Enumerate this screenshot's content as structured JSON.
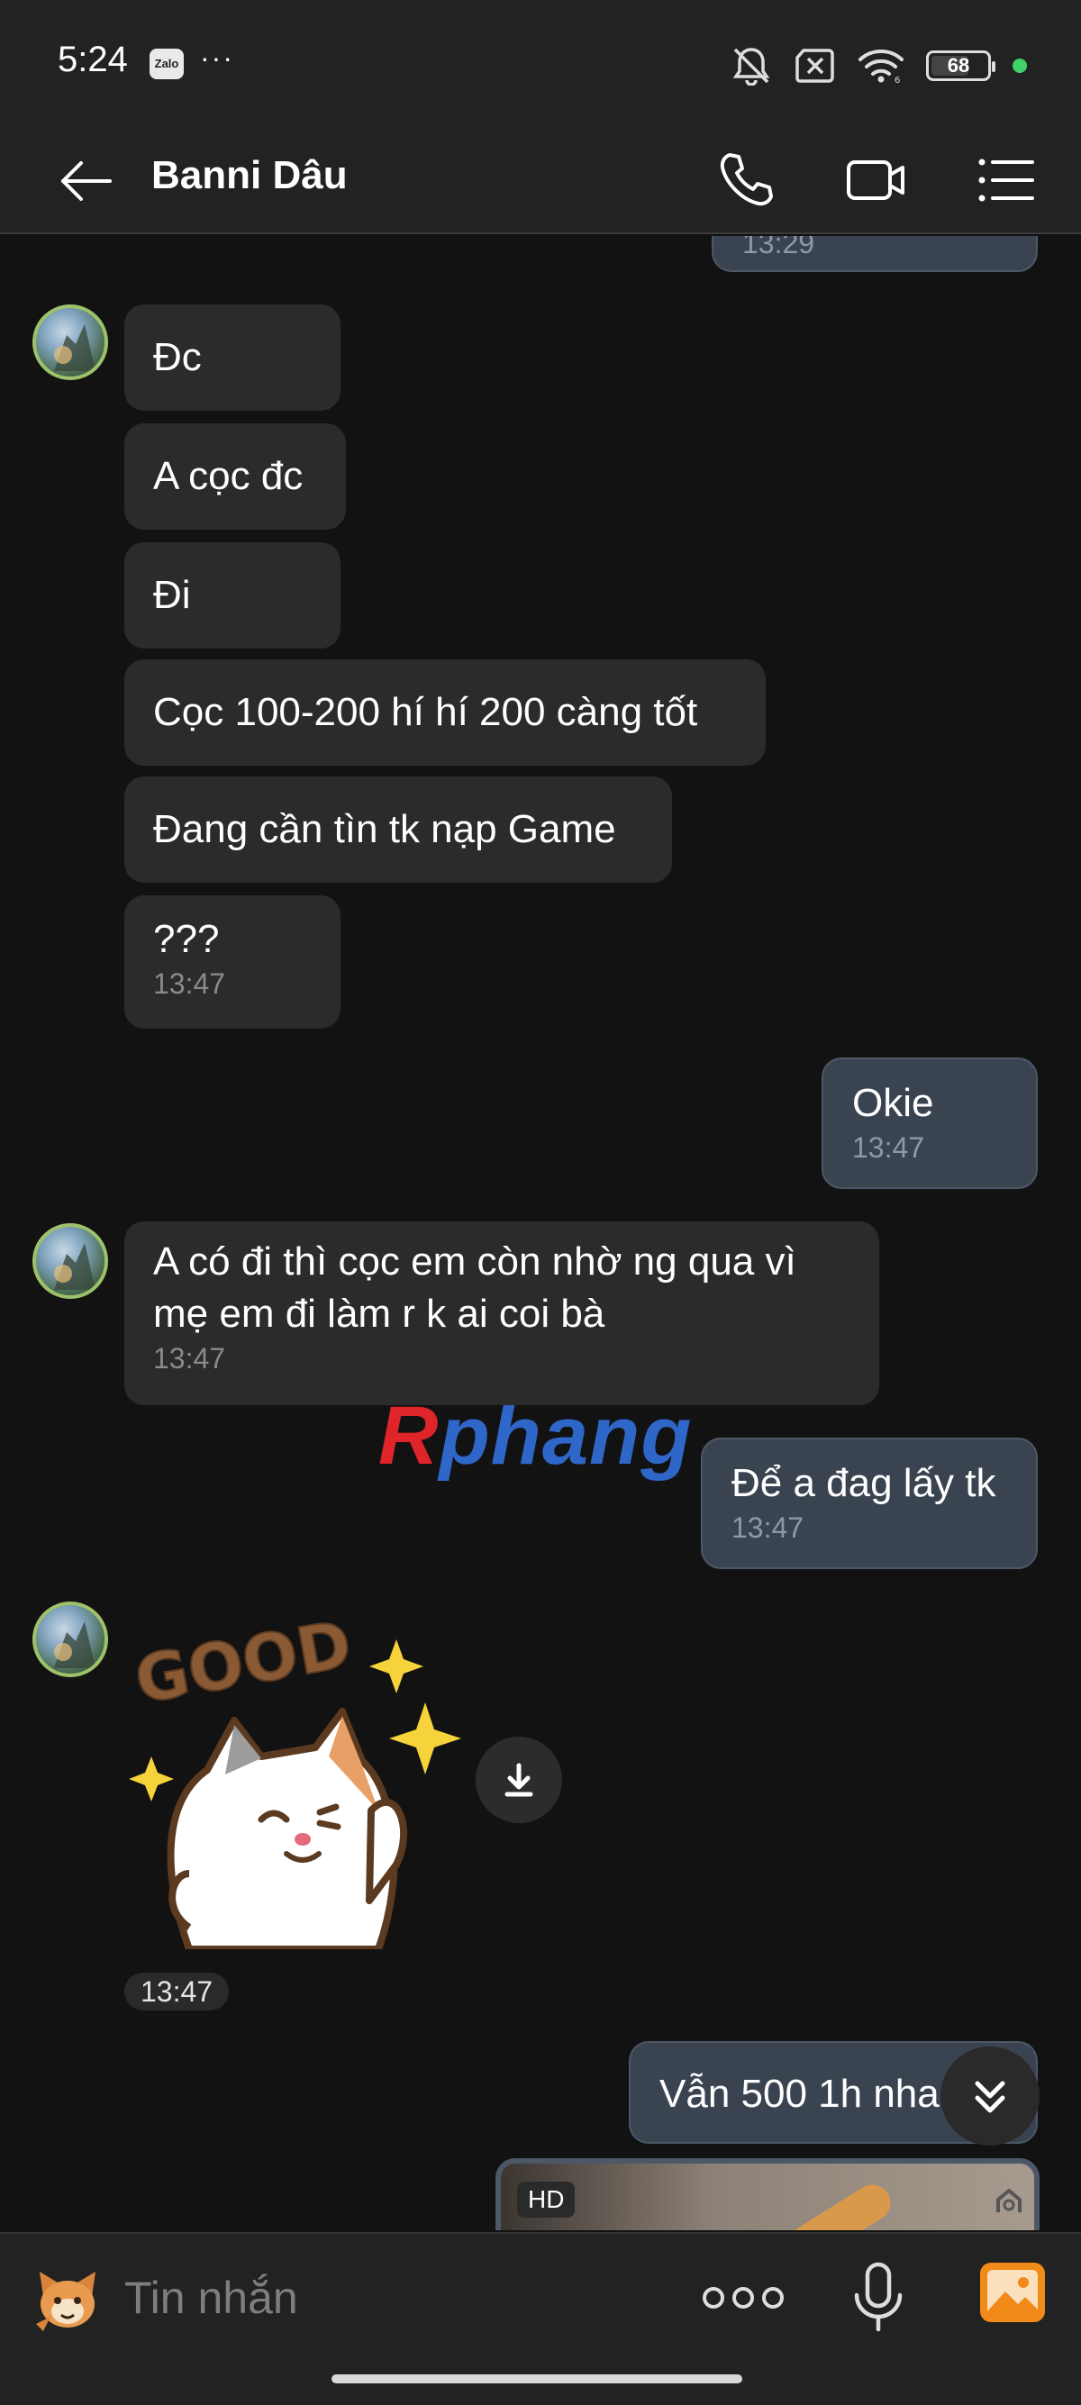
{
  "status_bar": {
    "time": "5:24",
    "app_badge": "Zalo",
    "more": "···",
    "battery": "68",
    "battery_level_percent": 68
  },
  "header": {
    "contact_name": "Banni Dâu"
  },
  "messages": {
    "top_partial_time": "13:29",
    "m1": "Đc",
    "m2": "A cọc đc",
    "m3": "Đi",
    "m4": "Cọc 100-200 hí hí 200 càng tốt",
    "m5": "Đang cần tìn tk nạp Game",
    "m6": "???",
    "m6_time": "13:47",
    "out1": "Okie",
    "out1_time": "13:47",
    "m7": "A có đi thì cọc em còn nhờ ng qua vì mẹ em đi làm r k ai coi bà",
    "m7_time": "13:47",
    "out2": "Để a đag lấy tk",
    "out2_time": "13:47",
    "sticker_text": "GOOD",
    "sticker_time": "13:47",
    "out3": "Vẫn 500 1h nha",
    "image_badge": "HD"
  },
  "watermark": {
    "letter": "R",
    "rest": "phang",
    "color_a": "#e0252a",
    "color_b": "#2f67c9"
  },
  "input": {
    "placeholder": "Tin nhắn"
  },
  "colors": {
    "incoming_bubble": "#2b2b2b",
    "outgoing_bubble": "#3a4350",
    "accent_gallery": "#f28a1a",
    "online": "#3fd36a"
  }
}
